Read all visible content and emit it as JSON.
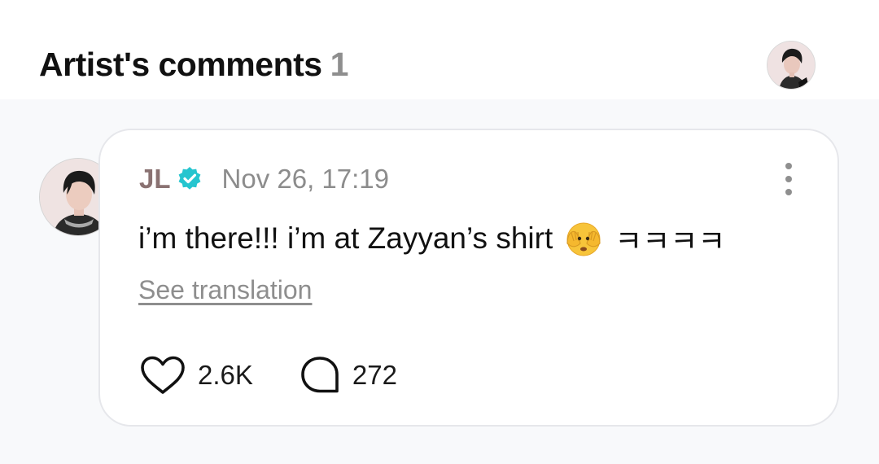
{
  "header": {
    "title": "Artist's comments",
    "count": "1",
    "avatar_icon": "profile-avatar"
  },
  "comment": {
    "author": "JL",
    "verified_icon": "verified-badge-icon",
    "verified_color": "#25c5cf",
    "author_color": "#8a7272",
    "timestamp": "Nov 26, 17:19",
    "text_before": "i’m there!!! i’m at Zayyan’s shirt",
    "emoji_icon": "face-with-peeking-eye-emoji",
    "text_after": "ㅋㅋㅋㅋ",
    "see_translation": "See translation",
    "likes": "2.6K",
    "replies": "272"
  }
}
